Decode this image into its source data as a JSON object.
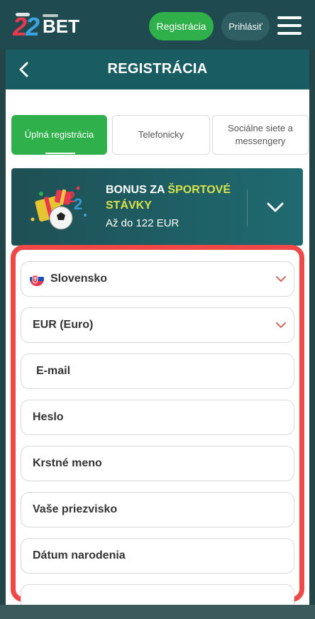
{
  "header": {
    "logo_text": "22BET",
    "register_button": "Registrácia",
    "login_button": "Prihlásiť",
    "menu_icon": "hamburger-menu-icon"
  },
  "title_bar": {
    "title": "REGISTRÁCIA",
    "back_icon": "back-arrow-icon"
  },
  "tabs": [
    {
      "label": "Úplná registrácia",
      "active": true
    },
    {
      "label": "Telefonicky",
      "active": false
    },
    {
      "label": "Sociálne siete a messengery",
      "active": false
    }
  ],
  "bonus": {
    "title_part1": "BONUS ZA ",
    "title_highlight": "ŠPORTOVÉ",
    "title_part2": "STÁVKY",
    "amount": "Až do 122 EUR",
    "expand_icon": "chevron-down-icon"
  },
  "form": {
    "country": "Slovensko",
    "currency": "EUR (Euro)",
    "email_placeholder": "E-mail",
    "password_placeholder": "Heslo",
    "first_name_placeholder": "Krstné meno",
    "last_name_placeholder": "Vaše priezvisko",
    "birthdate_placeholder": "Dátum narodenia"
  },
  "colors": {
    "primary_green": "#2fb04a",
    "header_teal": "#1f4a4f",
    "highlight_yellow": "#d7e34a",
    "frame_red": "#f04747"
  }
}
